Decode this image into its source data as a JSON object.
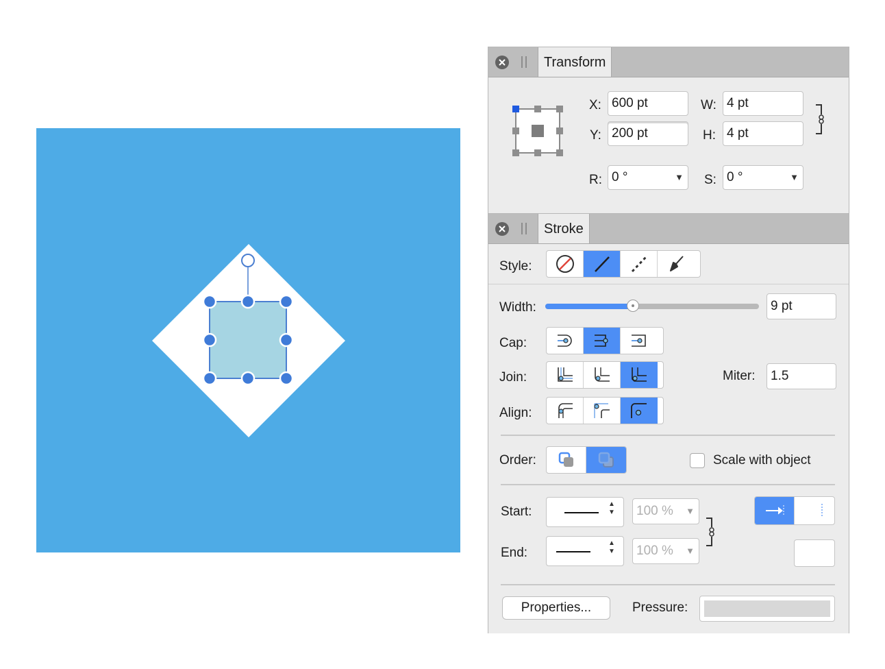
{
  "canvas": {
    "background_color": "#4eabe6",
    "shape_color": "#ffffff",
    "selection_fill": "#a6d5e3",
    "selection_stroke": "#4b7fd1"
  },
  "transform": {
    "tab_label": "Transform",
    "x_label": "X:",
    "x_value": "600 pt",
    "y_label": "Y:",
    "y_value": "200 pt",
    "w_label": "W:",
    "w_value": "4 pt",
    "h_label": "H:",
    "h_value": "4 pt",
    "r_label": "R:",
    "r_value": "0 °",
    "s_label": "S:",
    "s_value": "0 °",
    "anchor_selected": "top-left"
  },
  "stroke": {
    "tab_label": "Stroke",
    "style_label": "Style:",
    "style_options": [
      "none-style-icon",
      "solid-line-icon",
      "dashed-line-icon",
      "brush-icon"
    ],
    "style_selected": 1,
    "width_label": "Width:",
    "width_value": "9 pt",
    "width_slider_fraction": 0.41,
    "cap_label": "Cap:",
    "cap_selected": 1,
    "join_label": "Join:",
    "join_selected": 2,
    "miter_label": "Miter:",
    "miter_value": "1.5",
    "align_label": "Align:",
    "align_selected": 2,
    "order_label": "Order:",
    "order_selected": 1,
    "scale_label": "Scale with object",
    "scale_checked": false,
    "start_label": "Start:",
    "start_percent": "100 %",
    "end_label": "End:",
    "end_percent": "100 %",
    "properties_label": "Properties...",
    "pressure_label": "Pressure:",
    "accent_color": "#4d8ef5"
  }
}
